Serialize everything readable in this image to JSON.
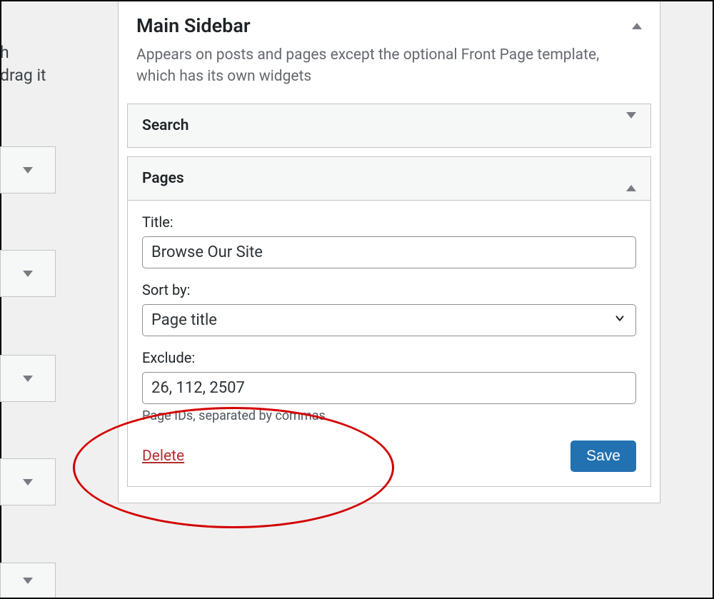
{
  "left": {
    "text_fragment_1": "h",
    "text_fragment_2": "drag it"
  },
  "sidebar_panel": {
    "title": "Main Sidebar",
    "description": "Appears on posts and pages except the optional Front Page template, which has its own widgets"
  },
  "widgets": {
    "search": {
      "title": "Search"
    },
    "pages": {
      "title": "Pages",
      "form": {
        "title_label": "Title:",
        "title_value": "Browse Our Site",
        "sort_label": "Sort by:",
        "sort_value": "Page title",
        "exclude_label": "Exclude:",
        "exclude_value": "26, 112, 2507",
        "exclude_help": "Page IDs, separated by commas."
      },
      "actions": {
        "delete": "Delete",
        "save": "Save"
      }
    }
  }
}
